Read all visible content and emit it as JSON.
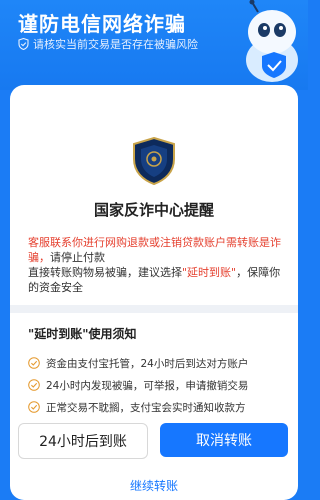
{
  "banner": {
    "title": "谨防电信网络诈骗",
    "subtitle": "请核实当前交易是否存在被骗风险"
  },
  "card": {
    "title": "国家反诈中心提醒",
    "warning_red": "客服联系你进行网购退款或注销贷款账户需转账是诈骗，",
    "warning_line2": "请停止付款",
    "warning_line3_a": "直接转账购物易被骗，建议选择",
    "warning_highlight": "\"延时到账\"",
    "warning_line3_b": "，保障你的资金安全"
  },
  "notice": {
    "title": "\"延时到账\"使用须知",
    "rules": [
      "资金由支付宝托管，24小时后到达对方账户",
      "24小时内发现被骗，可举报，申请撤销交易",
      "正常交易不耽搁，支付宝会实时通知收款方"
    ]
  },
  "actions": {
    "delay_label": "24小时后到账",
    "cancel_label": "取消转账",
    "continue_label": "继续转账"
  },
  "colors": {
    "brand_blue": "#1677ff",
    "warning_red": "#e5402f",
    "banner_blue": "#1f86f8"
  }
}
